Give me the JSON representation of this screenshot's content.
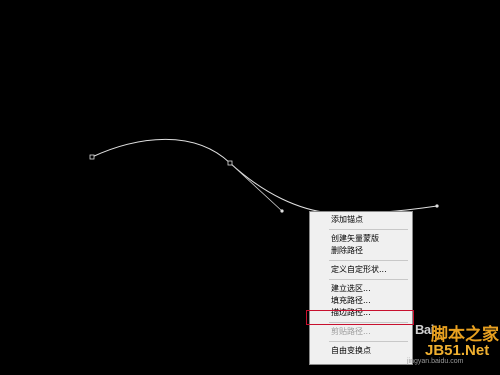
{
  "context_menu": {
    "items": [
      {
        "label": "添加锚点",
        "enabled": true
      },
      {
        "type": "separator"
      },
      {
        "label": "创建矢量蒙版",
        "enabled": true
      },
      {
        "label": "删除路径",
        "enabled": true
      },
      {
        "type": "separator"
      },
      {
        "label": "定义自定形状...",
        "enabled": true
      },
      {
        "type": "separator"
      },
      {
        "label": "建立选区...",
        "enabled": true
      },
      {
        "label": "填充路径...",
        "enabled": true
      },
      {
        "label": "描边路径...",
        "enabled": true,
        "highlighted": true
      },
      {
        "type": "separator"
      },
      {
        "label": "剪贴路径...",
        "enabled": false
      },
      {
        "type": "separator"
      },
      {
        "label": "自由变换点",
        "enabled": true
      }
    ]
  },
  "colors": {
    "background": "#000000",
    "path_stroke": "#e0e0e0",
    "highlight": "#c8102e",
    "watermark_orange": "#e8a020"
  },
  "watermark": {
    "logo_text": "Bai",
    "site_name": "脚本之家",
    "domain": "JB51.Net",
    "caption": "jingyan.baidu.com"
  }
}
